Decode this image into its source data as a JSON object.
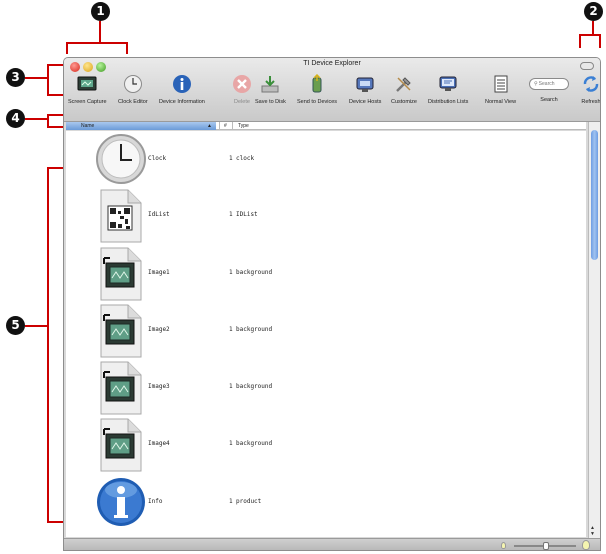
{
  "callouts": [
    "1",
    "2",
    "3",
    "4",
    "5"
  ],
  "window": {
    "title": "TI Device Explorer"
  },
  "toolbar": {
    "items": [
      {
        "label": "Screen Capture",
        "icon": "screen-capture-icon"
      },
      {
        "label": "Clock Editor",
        "icon": "clock-icon"
      },
      {
        "label": "Device Information",
        "icon": "info-icon"
      },
      {
        "label": "Delete",
        "icon": "delete-icon"
      },
      {
        "label": "Save to Disk",
        "icon": "save-disk-icon"
      },
      {
        "label": "Send to Devices",
        "icon": "send-devices-icon"
      },
      {
        "label": "Device Hosts",
        "icon": "device-hosts-icon"
      },
      {
        "label": "Customize",
        "icon": "customize-icon"
      },
      {
        "label": "Distribution Lists",
        "icon": "distribution-lists-icon"
      },
      {
        "label": "Normal View",
        "icon": "normal-view-icon"
      }
    ],
    "search_label": "Search",
    "search_placeholder": "Search",
    "refresh_label": "Refresh"
  },
  "columns": {
    "name": "Name",
    "count": "#",
    "type": "Type"
  },
  "rows": [
    {
      "name": "Clock",
      "count": "1",
      "type": "clock",
      "icon": "clock-icon"
    },
    {
      "name": "IdList",
      "count": "1",
      "type": "IDList",
      "icon": "qr-document-icon"
    },
    {
      "name": "Image1",
      "count": "1",
      "type": "background",
      "icon": "image-document-icon"
    },
    {
      "name": "Image2",
      "count": "1",
      "type": "background",
      "icon": "image-document-icon"
    },
    {
      "name": "Image3",
      "count": "1",
      "type": "background",
      "icon": "image-document-icon"
    },
    {
      "name": "Image4",
      "count": "1",
      "type": "background",
      "icon": "image-document-icon"
    },
    {
      "name": "Info",
      "count": "1",
      "type": "product",
      "icon": "info-icon"
    }
  ],
  "colors": {
    "callout": "#111111",
    "bracket": "#cc0000",
    "selection": "#6b9bd8"
  }
}
